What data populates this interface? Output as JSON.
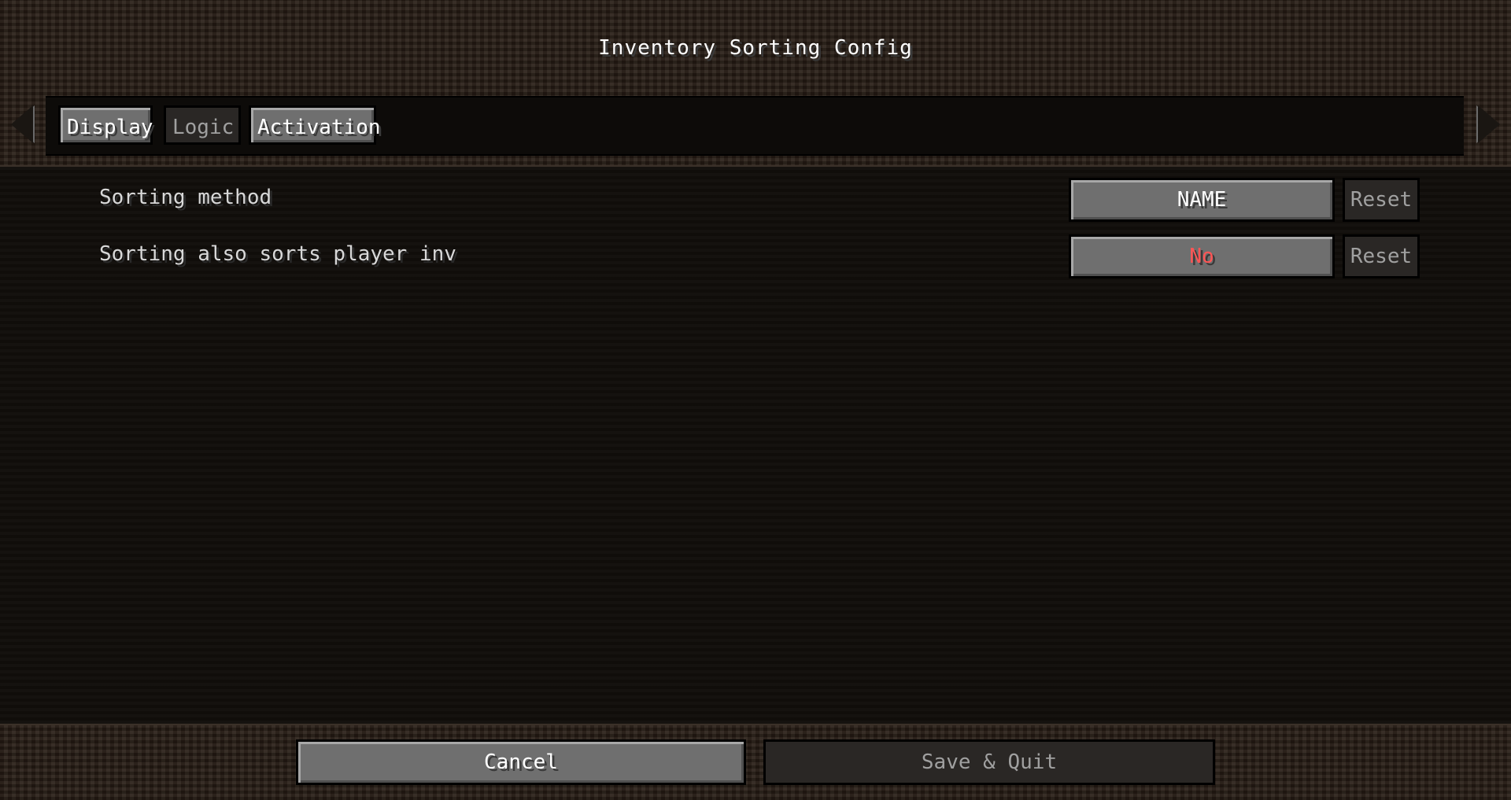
{
  "screen": {
    "title": "Inventory Sorting Config"
  },
  "tabs": [
    {
      "label": "Display",
      "active": false
    },
    {
      "label": "Logic",
      "active": true
    },
    {
      "label": "Activation",
      "active": false
    }
  ],
  "options": [
    {
      "label": "Sorting method",
      "value": "NAME",
      "reset": "Reset",
      "value_color": "#ffffff"
    },
    {
      "label": "Sorting also sorts player inv",
      "value": "No",
      "reset": "Reset",
      "value_color": "#ff5555"
    }
  ],
  "footer": {
    "cancel_label": "Cancel",
    "save_label": "Save & Quit"
  },
  "icons": {
    "left": "arrow-left-icon",
    "right": "arrow-right-icon"
  }
}
